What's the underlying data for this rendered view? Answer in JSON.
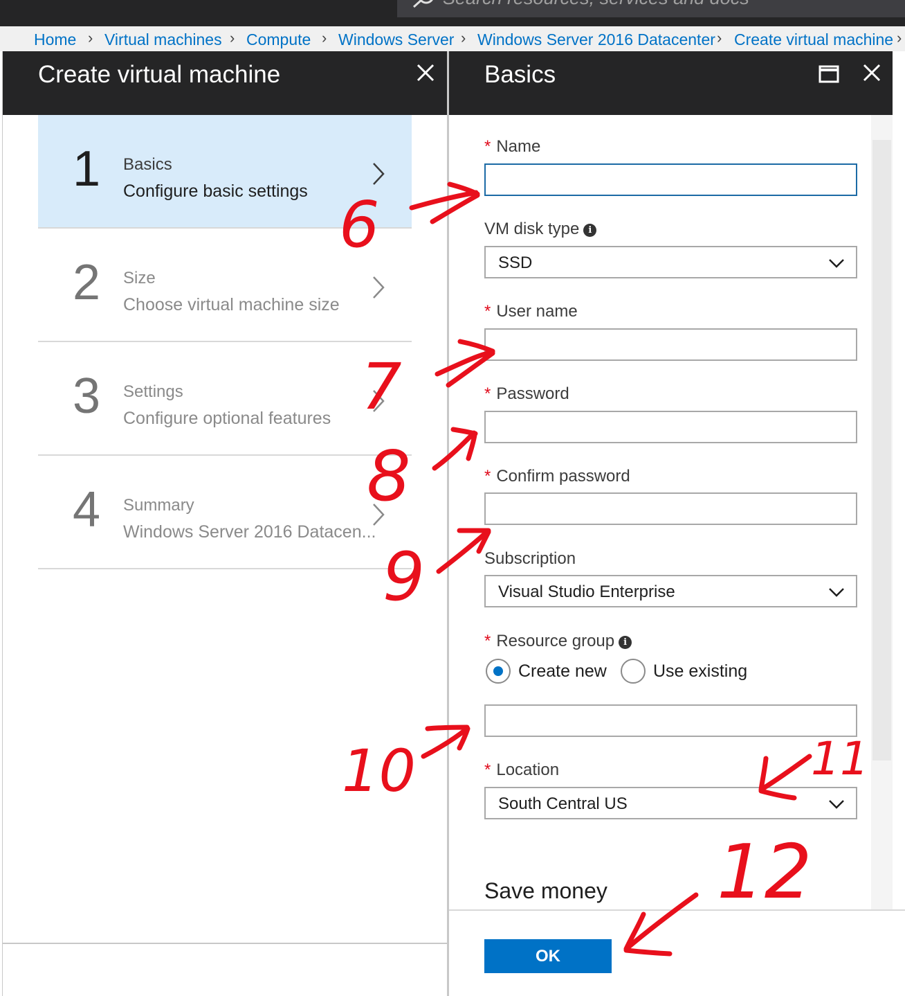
{
  "search": {
    "placeholder": "Search resources, services and docs"
  },
  "breadcrumb": [
    "Home",
    "Virtual machines",
    "Compute",
    "Windows Server",
    "Windows Server 2016 Datacenter",
    "Create virtual machine"
  ],
  "left_blade": {
    "title": "Create virtual machine",
    "steps": [
      {
        "number": "1",
        "title": "Basics",
        "subtitle": "Configure basic settings",
        "active": true
      },
      {
        "number": "2",
        "title": "Size",
        "subtitle": "Choose virtual machine size",
        "active": false
      },
      {
        "number": "3",
        "title": "Settings",
        "subtitle": "Configure optional features",
        "active": false
      },
      {
        "number": "4",
        "title": "Summary",
        "subtitle": "Windows Server 2016 Datacen...",
        "active": false
      }
    ]
  },
  "right_blade": {
    "title": "Basics",
    "fields": {
      "name": {
        "label": "Name",
        "required": "*",
        "value": ""
      },
      "disk_type": {
        "label": "VM disk type",
        "value": "SSD"
      },
      "user_name": {
        "label": "User name",
        "required": "*",
        "value": ""
      },
      "password": {
        "label": "Password",
        "required": "*",
        "value": ""
      },
      "confirm_password": {
        "label": "Confirm password",
        "required": "*",
        "value": ""
      },
      "subscription": {
        "label": "Subscription",
        "value": "Visual Studio Enterprise"
      },
      "resource_group": {
        "label": "Resource group",
        "required": "*",
        "options": [
          "Create new",
          "Use existing"
        ],
        "selected": "Create new",
        "value": ""
      },
      "location": {
        "label": "Location",
        "required": "*",
        "value": "South Central US"
      }
    },
    "section_heading": "Save money",
    "ok_label": "OK"
  },
  "annotations": [
    "6",
    "7",
    "8",
    "9",
    "10",
    "11",
    "12"
  ],
  "colors": {
    "accent": "#0072c6",
    "header": "#252526",
    "active_step": "#d8ebfa",
    "annotation": "#e8101c",
    "required": "#e00b1c"
  }
}
